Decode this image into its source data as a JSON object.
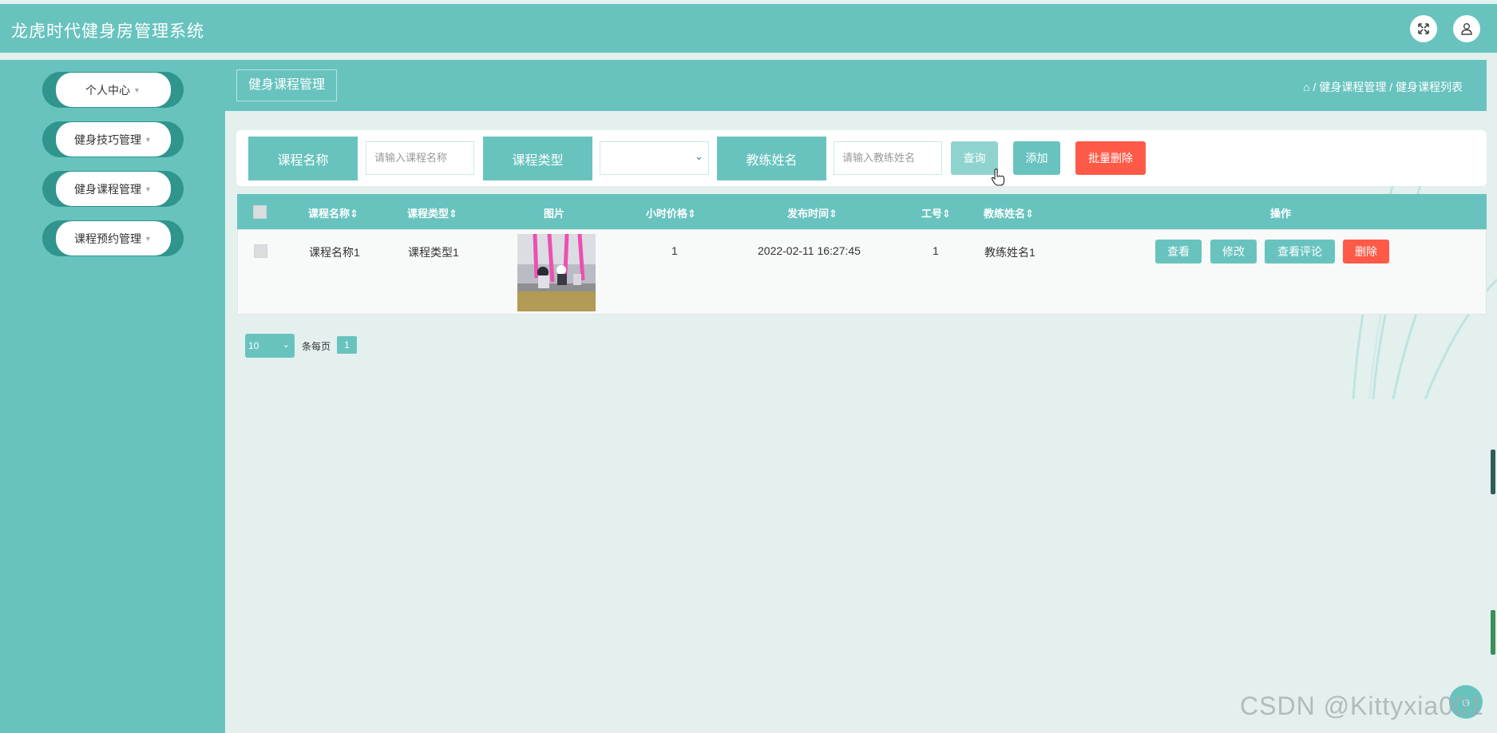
{
  "app": {
    "title": "龙虎时代健身房管理系统"
  },
  "topbar": {
    "fullscreen_icon": "expand-icon",
    "user_icon": "user-icon"
  },
  "sidebar": {
    "items": [
      {
        "label": "个人中心"
      },
      {
        "label": "健身技巧管理"
      },
      {
        "label": "健身课程管理"
      },
      {
        "label": "课程预约管理"
      }
    ]
  },
  "page": {
    "title": "健身课程管理",
    "breadcrumb": {
      "home_icon": "home-icon",
      "sep": " / ",
      "items": [
        "健身课程管理",
        "健身课程列表"
      ]
    }
  },
  "search": {
    "course_name_label": "课程名称",
    "course_name_placeholder": "请输入课程名称",
    "course_type_label": "课程类型",
    "course_type_value": "",
    "coach_name_label": "教练姓名",
    "coach_name_placeholder": "请输入教练姓名",
    "query_label": "查询",
    "add_label": "添加",
    "batch_delete_label": "批量删除"
  },
  "table": {
    "columns": [
      "课程名称",
      "课程类型",
      "图片",
      "小时价格",
      "发布时间",
      "工号",
      "教练姓名",
      "操作"
    ],
    "sort_glyph": "⇕",
    "rows": [
      {
        "course_name": "课程名称1",
        "course_type": "课程类型1",
        "price": "1",
        "publish_time": "2022-02-11 16:27:45",
        "job_no": "1",
        "coach_name": "教练姓名1",
        "actions": {
          "view": "查看",
          "edit": "修改",
          "comments": "查看评论",
          "delete": "删除"
        }
      }
    ]
  },
  "pager": {
    "page_size": "10",
    "per_page_text": "条每页",
    "current_page": "1"
  },
  "watermark": "CSDN @Kittyxia001",
  "colors": {
    "primary": "#68c3bf",
    "danger": "#ff5a47",
    "sidebar_pill": "#2f958d",
    "background": "#e3f0ee"
  }
}
